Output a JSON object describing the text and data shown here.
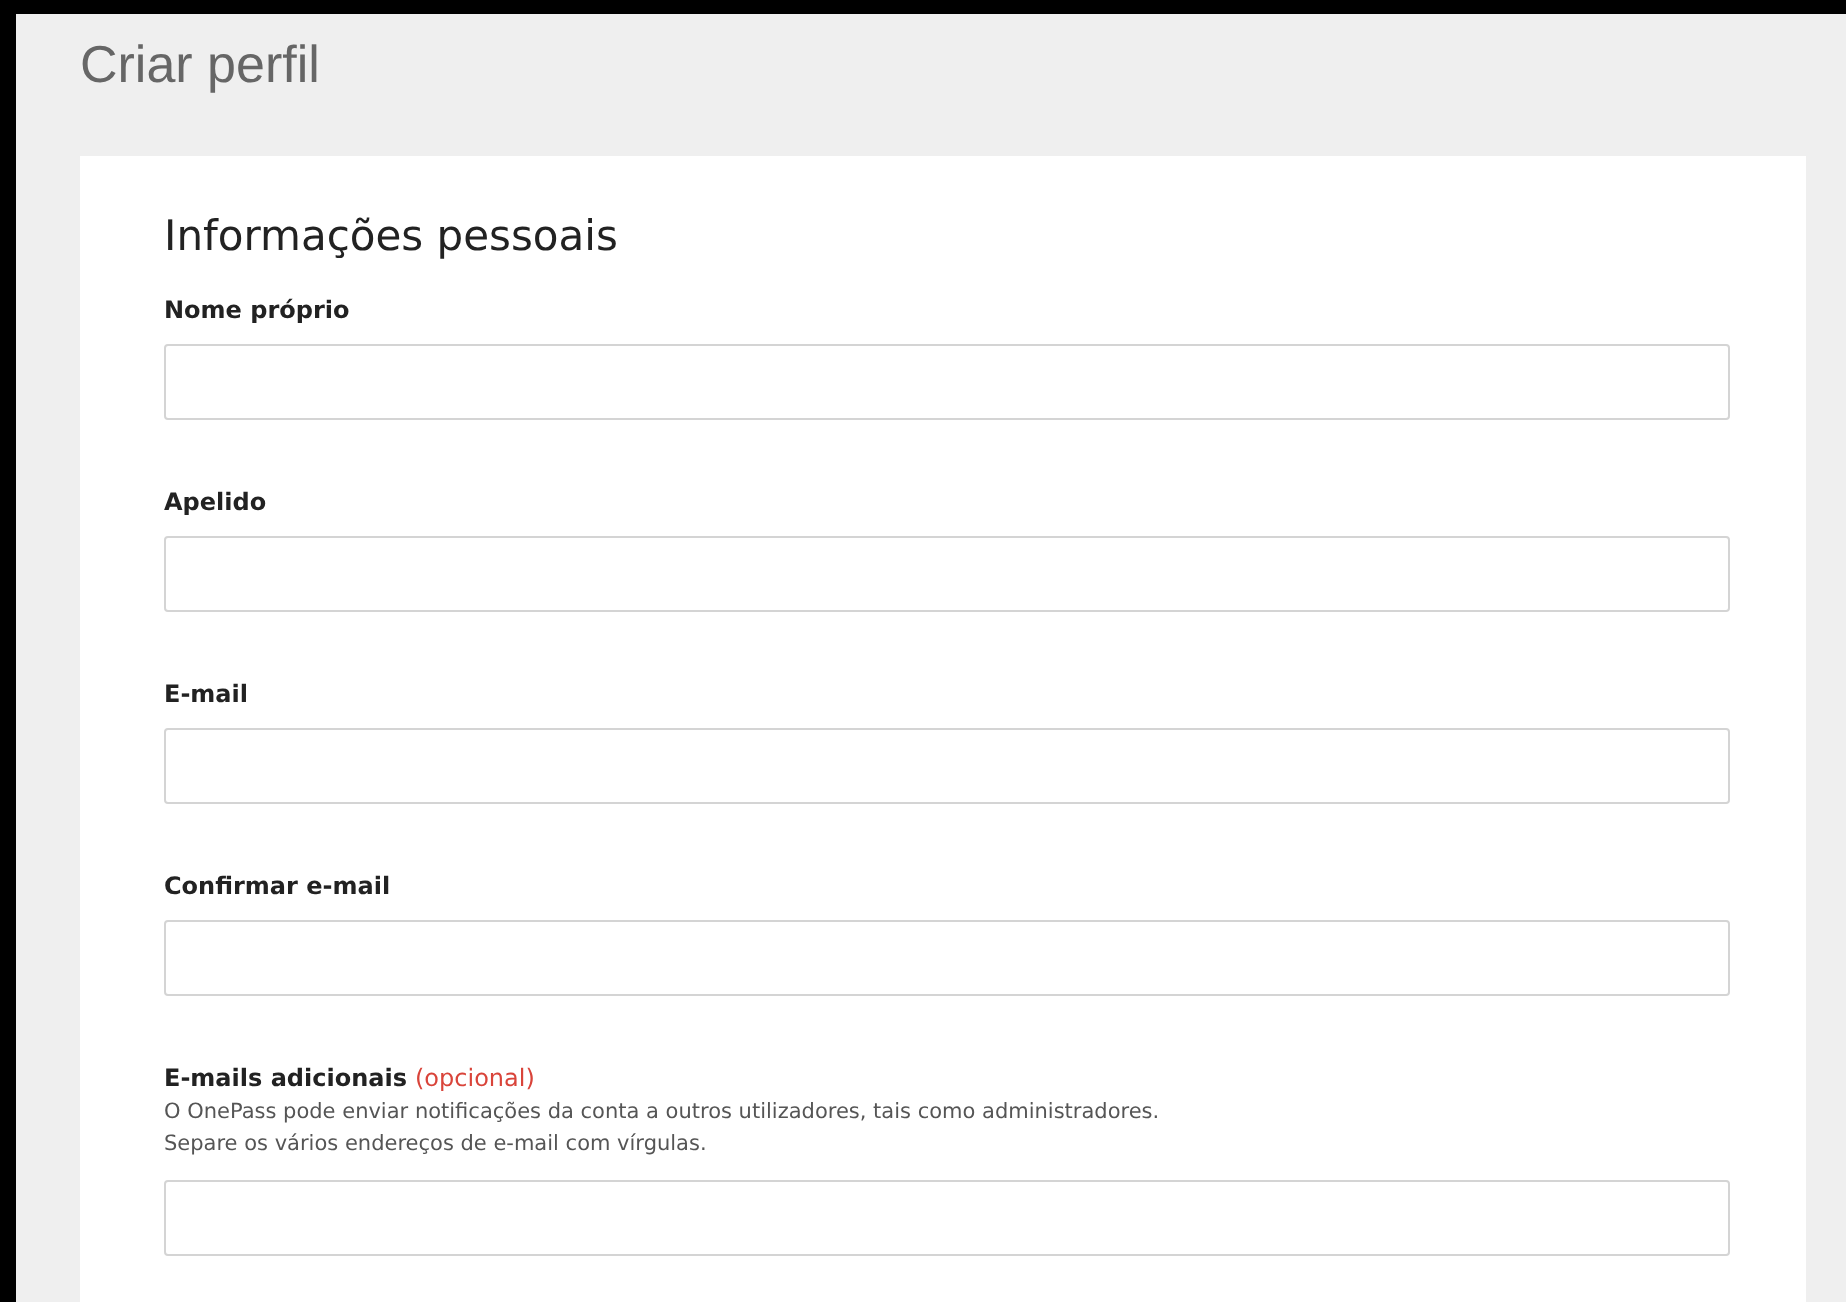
{
  "page": {
    "title": "Criar perfil"
  },
  "section": {
    "heading": "Informações pessoais"
  },
  "fields": [
    {
      "label": "Nome próprio"
    },
    {
      "label": "Apelido"
    },
    {
      "label": "E-mail"
    },
    {
      "label": "Confirmar e-mail"
    },
    {
      "label": "E-mails adicionais",
      "optional_tag": "(opcional)",
      "description": [
        "O OnePass pode enviar notificações da conta a outros utilizadores, tais como administradores.",
        "Separe os vários endereços de e-mail com vírgulas."
      ]
    }
  ]
}
